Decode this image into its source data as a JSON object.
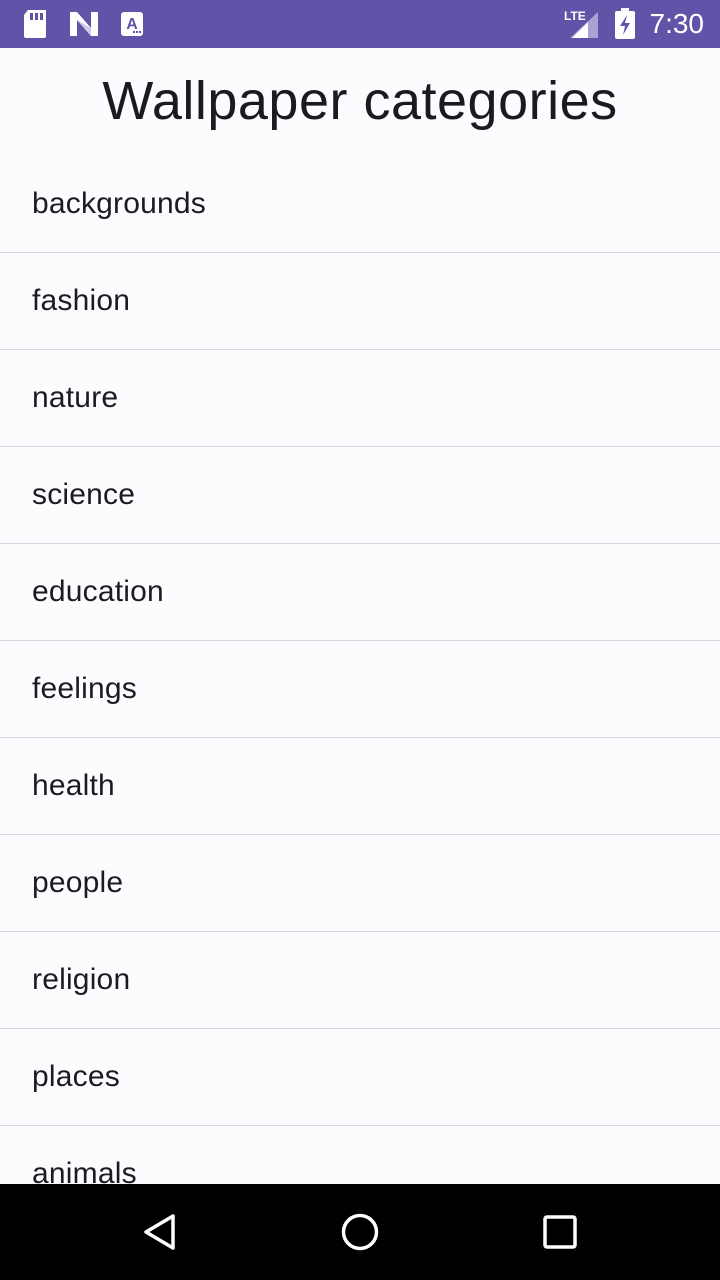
{
  "status_bar": {
    "time": "7:30",
    "network": "LTE",
    "background_color": "#6153a8",
    "icons": [
      "sd-card-icon",
      "n-notification-icon",
      "a-notification-icon",
      "lte-signal-icon",
      "battery-charging-icon"
    ]
  },
  "page": {
    "title": "Wallpaper categories"
  },
  "categories": [
    "backgrounds",
    "fashion",
    "nature",
    "science",
    "education",
    "feelings",
    "health",
    "people",
    "religion",
    "places",
    "animals"
  ],
  "nav_bar": {
    "icons": [
      "back-icon",
      "home-icon",
      "recents-icon"
    ]
  }
}
